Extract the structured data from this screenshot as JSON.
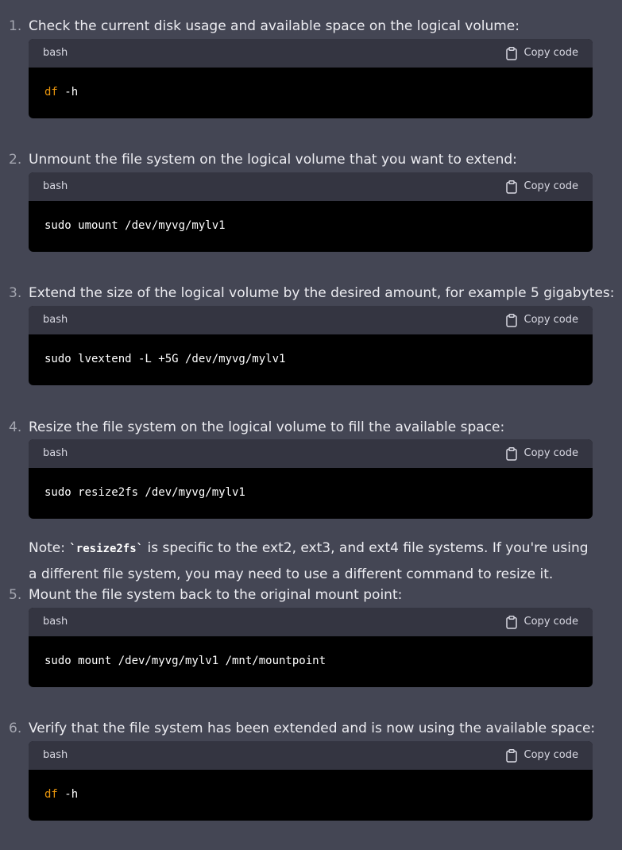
{
  "steps": [
    {
      "number": "1.",
      "text": "Check the current disk usage and available space on the logical volume:",
      "language": "bash",
      "copy_label": "Copy code",
      "code_cmd": "df",
      "code_args": " -h",
      "highlight": true
    },
    {
      "number": "2.",
      "text": "Unmount the file system on the logical volume that you want to extend:",
      "language": "bash",
      "copy_label": "Copy code",
      "code": "sudo umount /dev/myvg/mylv1"
    },
    {
      "number": "3.",
      "text": "Extend the size of the logical volume by the desired amount, for example 5 gigabytes:",
      "language": "bash",
      "copy_label": "Copy code",
      "code": "sudo lvextend -L +5G /dev/myvg/mylv1"
    },
    {
      "number": "4.",
      "text": "Resize the file system on the logical volume to fill the available space:",
      "language": "bash",
      "copy_label": "Copy code",
      "code": "sudo resize2fs /dev/myvg/mylv1"
    },
    {
      "number": "5.",
      "text": "Mount the file system back to the original mount point:",
      "language": "bash",
      "copy_label": "Copy code",
      "code": "sudo mount /dev/myvg/mylv1 /mnt/mountpoint"
    },
    {
      "number": "6.",
      "text": "Verify that the file system has been extended and is now using the available space:",
      "language": "bash",
      "copy_label": "Copy code",
      "code_cmd": "df",
      "code_args": " -h",
      "highlight": true
    }
  ],
  "note": {
    "prefix": "Note: ",
    "code": "`resize2fs`",
    "suffix": " is specific to the ext2, ext3, and ext4 file systems. If you're using a different file system, you may need to use a different command to resize it."
  },
  "colors": {
    "background": "#444654",
    "code_header": "#343541",
    "code_body": "#000000",
    "keyword": "#e9950c"
  }
}
